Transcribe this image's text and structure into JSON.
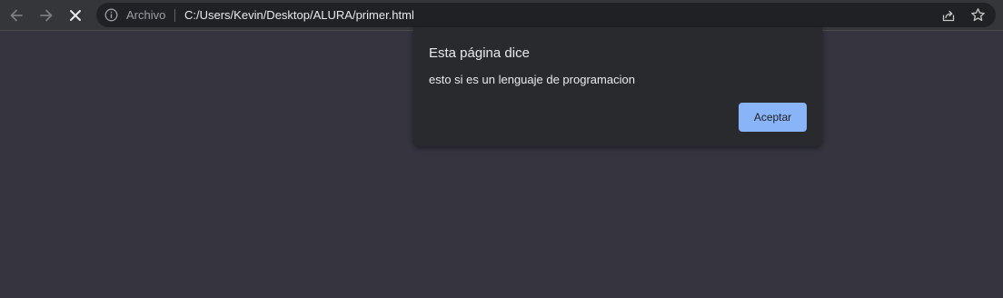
{
  "toolbar": {
    "back_icon": "arrow-left-icon",
    "forward_icon": "arrow-right-icon",
    "stop_icon": "close-icon"
  },
  "omnibox": {
    "security_icon": "info-icon",
    "scheme_label": "Archivo",
    "url": "C:/Users/Kevin/Desktop/ALURA/primer.html",
    "share_icon": "share-icon",
    "bookmark_icon": "star-icon"
  },
  "dialog": {
    "title": "Esta página dice",
    "message": "esto si es un lenguaje de programacion",
    "ok_label": "Aceptar"
  },
  "colors": {
    "page_background": "#35343f",
    "toolbar_background": "#35363a",
    "omnibox_background": "#202124",
    "dialog_background": "#292a2d",
    "accent": "#8ab4f8"
  }
}
